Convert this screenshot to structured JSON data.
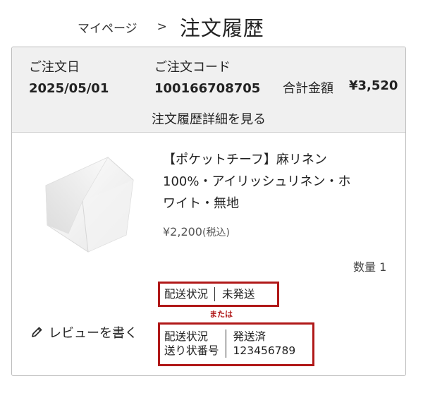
{
  "breadcrumb": {
    "parent": "マイページ",
    "separator": ">",
    "current": "注文履歴"
  },
  "order": {
    "date_label": "ご注文日",
    "date_value": "2025/05/01",
    "code_label": "ご注文コード",
    "code_value": "100166708705",
    "total_label": "合計金額",
    "total_value": "¥3,520",
    "detail_link": "注文履歴詳細を見る"
  },
  "product": {
    "title_line1": "【ポケットチーフ】麻リネン",
    "title_line2": "100%・アイリッシュリネン・ホ",
    "title_line3": "ワイト・無地",
    "price": "¥2,200",
    "tax_note": "(税込)",
    "quantity": "数量 1"
  },
  "shipping": {
    "status_label": "配送状況",
    "status_unshipped": "未発送",
    "or_text": "または",
    "tracking_label": "送り状番号",
    "status_shipped": "発送済",
    "tracking_number": "123456789"
  },
  "review": {
    "label": "レビューを書く"
  },
  "colors": {
    "highlight": "#b01818",
    "header_bg": "#f0f0f0"
  }
}
